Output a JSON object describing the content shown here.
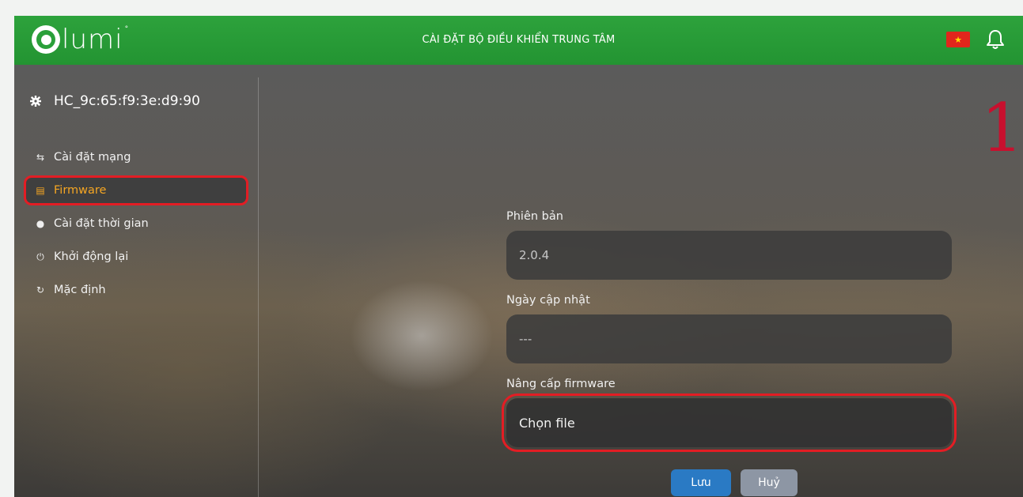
{
  "header": {
    "brand": "lumi",
    "title": "CÀI ĐẶT BỘ ĐIỀU KHIỂN TRUNG TÂM",
    "flag_color": "#e1261c",
    "flag_star": "★"
  },
  "sidebar": {
    "device_name": "HC_9c:65:f9:3e:d9:90",
    "items": [
      {
        "label": "Cài đặt mạng",
        "icon": "⇆"
      },
      {
        "label": "Firmware",
        "icon": "▤"
      },
      {
        "label": "Cài đặt thời gian",
        "icon": "●"
      },
      {
        "label": "Khởi động lại",
        "icon": "⏻"
      },
      {
        "label": "Mặc định",
        "icon": "↻"
      }
    ]
  },
  "form": {
    "version_label": "Phiên bản",
    "version_value": "2.0.4",
    "updated_label": "Ngày cập nhật",
    "updated_value": "---",
    "upgrade_label": "Nâng cấp firmware",
    "choose_file": "Chọn file"
  },
  "buttons": {
    "save": "Lưu",
    "cancel": "Huỷ"
  },
  "annotation": "1",
  "colors": {
    "header": "#239432",
    "active": "#f5a623",
    "highlight": "#e31d24",
    "save": "#2a7ac4",
    "cancel": "#8d96a4"
  }
}
